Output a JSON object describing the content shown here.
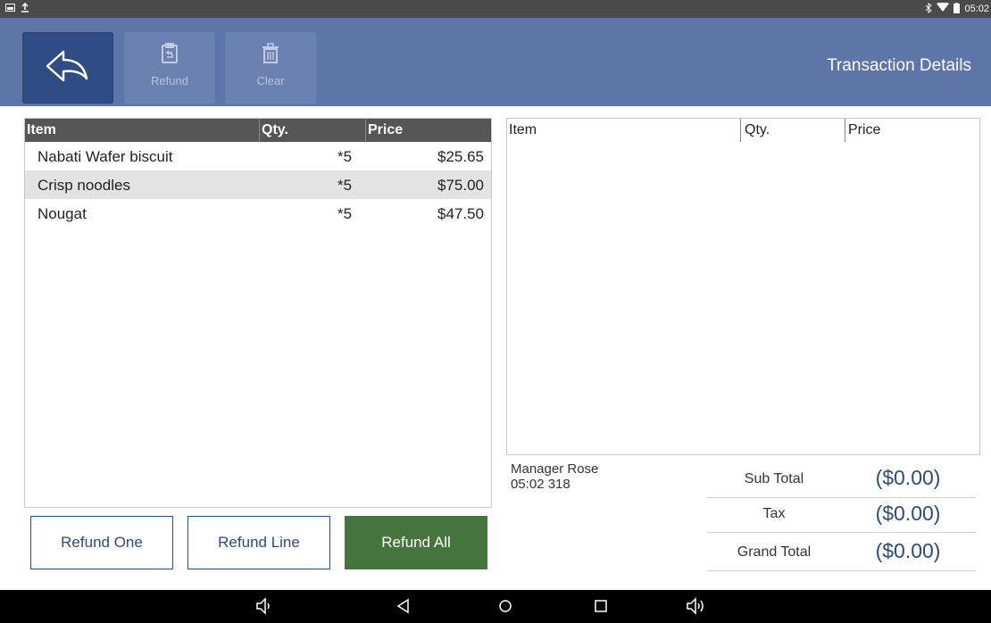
{
  "status_bar": {
    "left_icons": [
      "screenshot-icon",
      "upload-icon"
    ],
    "right_icons": [
      "bluetooth-icon",
      "wifi-icon",
      "battery-icon"
    ],
    "time": "05:02"
  },
  "toolbar": {
    "refund_label": "Refund",
    "clear_label": "Clear",
    "title": "Transaction Details"
  },
  "left_table": {
    "columns": [
      "Item",
      "Qty.",
      "Price"
    ],
    "rows": [
      {
        "item": "Nabati Wafer biscuit",
        "qty": "*5",
        "price": "$25.65"
      },
      {
        "item": "Crisp noodles",
        "qty": "*5",
        "price": "$75.00"
      },
      {
        "item": "Nougat",
        "qty": "*5",
        "price": "$47.50"
      }
    ]
  },
  "right_table": {
    "columns": [
      "Item",
      "Qty.",
      "Price"
    ]
  },
  "manager": {
    "name": "Manager Rose",
    "time": "05:02 318"
  },
  "totals": {
    "sub_total_label": "Sub Total",
    "sub_total_value": "($0.00)",
    "tax_label": "Tax",
    "tax_value": "($0.00)",
    "grand_total_label": "Grand Total",
    "grand_total_value": "($0.00)"
  },
  "actions": {
    "refund_one": "Refund One",
    "refund_line": "Refund Line",
    "refund_all": "Refund All"
  },
  "colors": {
    "header": "#5e76a7",
    "primary": "#2e4a80",
    "green": "#45743f"
  }
}
